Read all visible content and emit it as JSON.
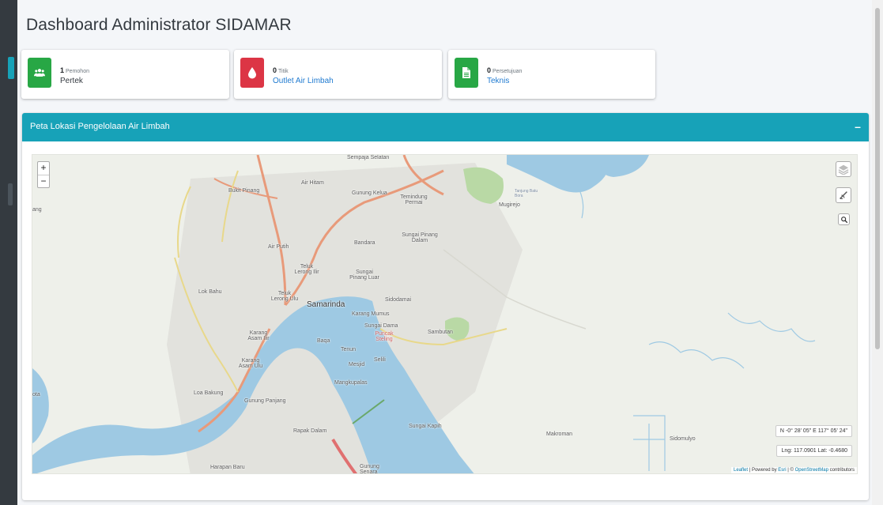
{
  "page": {
    "title": "Dashboard Administrator SIDAMAR"
  },
  "info_boxes": [
    {
      "count": "1",
      "caption": "Pemohon",
      "label": "Pertek",
      "color": "#28a745",
      "icon": "users-icon",
      "label_color": "#343a40"
    },
    {
      "count": "0",
      "caption": "Titik",
      "label": "Outlet Air Limbah",
      "color": "#dc3545",
      "icon": "tint-icon",
      "label_color": "#1f7ad0"
    },
    {
      "count": "0",
      "caption": "Persetujuan",
      "label": "Teknis",
      "color": "#28a745",
      "icon": "file-icon",
      "label_color": "#1f7ad0"
    }
  ],
  "card": {
    "title": "Peta Lokasi Pengelolaan Air Limbah",
    "collapse_label": "–"
  },
  "map": {
    "zoom_in": "+",
    "zoom_out": "−",
    "controls": [
      "layers-icon",
      "measure-icon",
      "search-icon"
    ],
    "coordinates_dms": "N -0° 28' 05\" E 117° 05' 24\"",
    "coordinates_dec": "Lng: 117.0901 Lat: -0.4680",
    "attribution": {
      "leaflet": "Leaflet",
      "powered": " | Powered by ",
      "esri": "Esri",
      "sep": " | © ",
      "osm": "OpenStreetMap",
      "contributors": " contributors"
    },
    "place_labels": {
      "sempaja": "Sempaja Selatan",
      "bukit_pinang": "Bukit Pinang",
      "air_hitam": "Air Hitam",
      "gunung_kelua": "Gunung Kelua",
      "temindung": "Temindung Permai",
      "mugirejo": "Mugirejo",
      "tanjung": "Tanjung Batu Bora",
      "ang": "ang",
      "bandara": "Bandara",
      "sungai_pinang_dalam": "Sungai Pinang Dalam",
      "air_putih": "Air Putih",
      "teluk_lerong_ilir": "Teluk Lerong Ilir",
      "sungai_pinang_luar": "Sungai Pinang Luar",
      "lok_bahu": "Lok Bahu",
      "teluk_lerong_ulu": "Teluk Lerong Ulu",
      "samarinda": "Samarinda",
      "sidodamai": "Sidodamai",
      "karang_mumus": "Karang Mumus",
      "sungai_dama": "Sungai Dama",
      "puncak_steling": "Puncak Steling",
      "sambutan": "Sambutan",
      "karang_asam_ilir": "Karang Asam Ilir",
      "baqa": "Baqa",
      "tenun": "Tenun",
      "mesjid": "Mesjid",
      "selili": "Selili",
      "karang_asam_ulu": "Karang Asam Ulu",
      "mangkupalas": "Mangkupalas",
      "loa_bakung": "Loa Bakung",
      "gunung_panjang": "Gunung Panjang",
      "ota": "ota",
      "rapak_dalam": "Rapak Dalam",
      "sungai_kapih": "Sungai Kapih",
      "makroman": "Makroman",
      "sidomulyo": "Sidomulyo",
      "harapan_baru": "Harapan Baru",
      "gunung_senara": "Gunung Senara"
    }
  }
}
